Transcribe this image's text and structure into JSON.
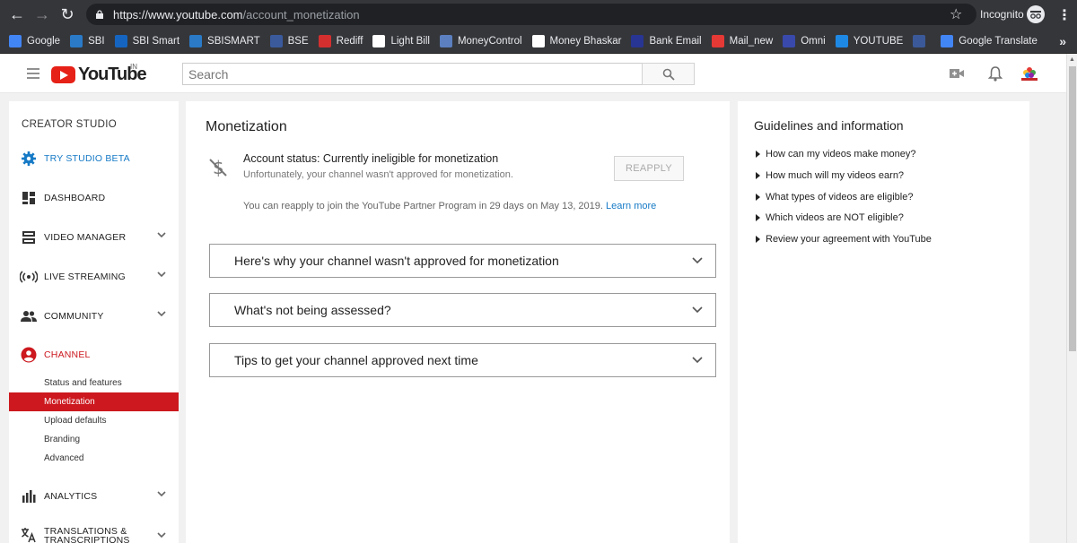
{
  "browser": {
    "url_host": "https://www.youtube.com",
    "url_path": "/account_monetization",
    "incognito_label": "Incognito"
  },
  "bookmarks": [
    {
      "label": "Google",
      "color": "#4285f4"
    },
    {
      "label": "SBI",
      "color": "#2a7ac7"
    },
    {
      "label": "SBI Smart",
      "color": "#1565c0"
    },
    {
      "label": "SBISMART",
      "color": "#2a7ac7"
    },
    {
      "label": "BSE",
      "color": "#3a5a9c"
    },
    {
      "label": "Rediff",
      "color": "#d32f2f"
    },
    {
      "label": "Light Bill",
      "color": "#ffffff"
    },
    {
      "label": "MoneyControl",
      "color": "#5b7fbf"
    },
    {
      "label": "Money Bhaskar",
      "color": "#ffffff"
    },
    {
      "label": "Bank Email",
      "color": "#283593"
    },
    {
      "label": "Mail_new",
      "color": "#e53935"
    },
    {
      "label": "Omni",
      "color": "#3949ab"
    },
    {
      "label": "YOUTUBE",
      "color": "#1e88e5"
    },
    {
      "label": "",
      "color": "#3b5998"
    },
    {
      "label": "Google Translate",
      "color": "#4285f4"
    }
  ],
  "header": {
    "logo_text": "YouTube",
    "region": "IN",
    "search_placeholder": "Search"
  },
  "sidebar": {
    "title": "CREATOR STUDIO",
    "items": [
      {
        "label": "TRY STUDIO BETA",
        "icon": "gear-icon"
      },
      {
        "label": "DASHBOARD",
        "icon": "dashboard-icon"
      },
      {
        "label": "VIDEO MANAGER",
        "icon": "video-manager-icon"
      },
      {
        "label": "LIVE STREAMING",
        "icon": "live-icon"
      },
      {
        "label": "COMMUNITY",
        "icon": "people-icon"
      },
      {
        "label": "CHANNEL",
        "icon": "person-icon"
      },
      {
        "label": "ANALYTICS",
        "icon": "analytics-icon"
      },
      {
        "label": "TRANSLATIONS & TRANSCRIPTIONS",
        "icon": "translate-icon"
      }
    ],
    "channel_subitems": [
      "Status and features",
      "Monetization",
      "Upload defaults",
      "Branding",
      "Advanced"
    ]
  },
  "main": {
    "title": "Monetization",
    "status_title": "Account status: Currently ineligible for monetization",
    "status_sub": "Unfortunately, your channel wasn't approved for monetization.",
    "reapply_label": "REAPPLY",
    "reapply_note": "You can reapply to join the YouTube Partner Program in 29 days on May 13, 2019.",
    "learn_more": "Learn more",
    "accordions": [
      "Here's why your channel wasn't approved for monetization",
      "What's not being assessed?",
      "Tips to get your channel approved next time"
    ]
  },
  "right": {
    "title": "Guidelines and information",
    "links": [
      "How can my videos make money?",
      "How much will my videos earn?",
      "What types of videos are eligible?",
      "Which videos are NOT eligible?",
      "Review your agreement with YouTube"
    ]
  },
  "colors": {
    "accent_red": "#cc181e",
    "link_blue": "#167ac6"
  }
}
